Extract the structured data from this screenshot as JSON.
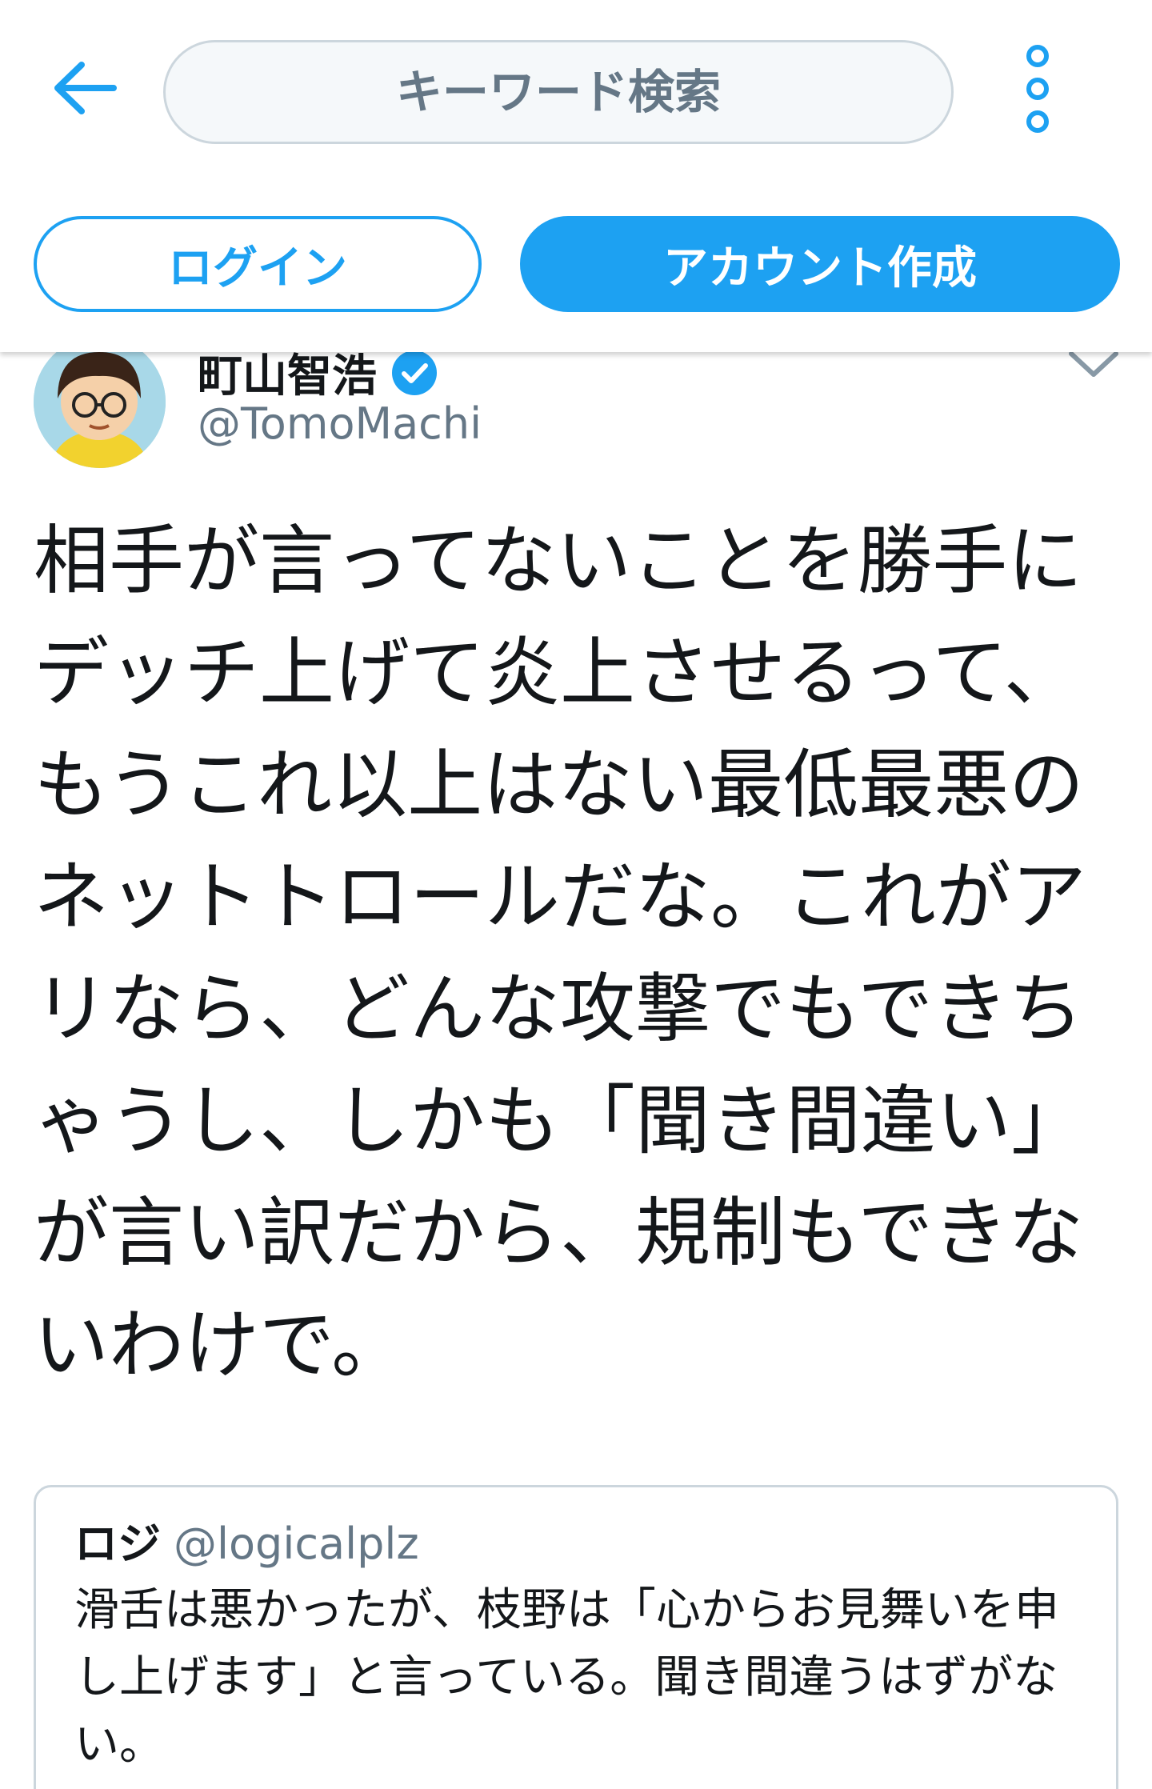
{
  "header": {
    "search_placeholder": "キーワード検索",
    "login_label": "ログイン",
    "signup_label": "アカウント作成"
  },
  "tweet": {
    "author_name": "町山智浩",
    "author_handle": "@TomoMachi",
    "text": "相手が言ってないことを勝手にデッチ上げて炎上させるって、もうこれ以上はない最低最悪のネットトロールだな。これがアリなら、どんな攻撃でもできちゃうし、しかも「聞き間違い」が言い訳だから、規制もできないわけで。"
  },
  "quoted": {
    "author_name": "ロジ",
    "author_handle": "@logicalplz",
    "text": "滑舌は悪かったが、枝野は「心からお見舞いを申し上げます」と言っている。聞き間違うはずがない。"
  },
  "colors": {
    "accent": "#1da1f2",
    "text": "#14171a",
    "secondary_text": "#657786",
    "border": "#ccd6dd"
  },
  "icons": [
    "back-arrow-icon",
    "more-options-icon",
    "verified-badge-icon",
    "chevron-down-icon"
  ]
}
